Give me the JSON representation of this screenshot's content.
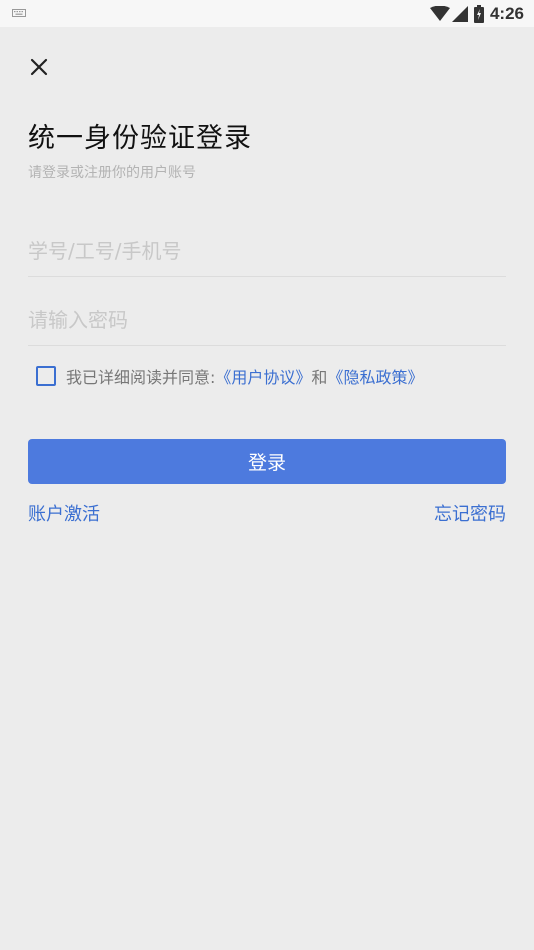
{
  "status_bar": {
    "time": "4:26",
    "icons": [
      "keyboard-icon",
      "wifi-icon",
      "signal-icon",
      "battery-icon"
    ]
  },
  "header": {
    "close_icon": "close-icon",
    "title": "统一身份验证登录",
    "subtitle": "请登录或注册你的用户账号"
  },
  "form": {
    "account_placeholder": "学号/工号/手机号",
    "account_value": "",
    "password_placeholder": "请输入密码",
    "password_value": ""
  },
  "agreement": {
    "checked": false,
    "prefix": "我已详细阅读并同意:",
    "user_agreement": "《用户协议》",
    "and": "和",
    "privacy_policy": "《隐私政策》"
  },
  "actions": {
    "login_label": "登录",
    "activate_label": "账户激活",
    "forgot_label": "忘记密码"
  },
  "colors": {
    "accent": "#3b6fd1",
    "button": "#4d7ade",
    "background": "#ececec"
  }
}
